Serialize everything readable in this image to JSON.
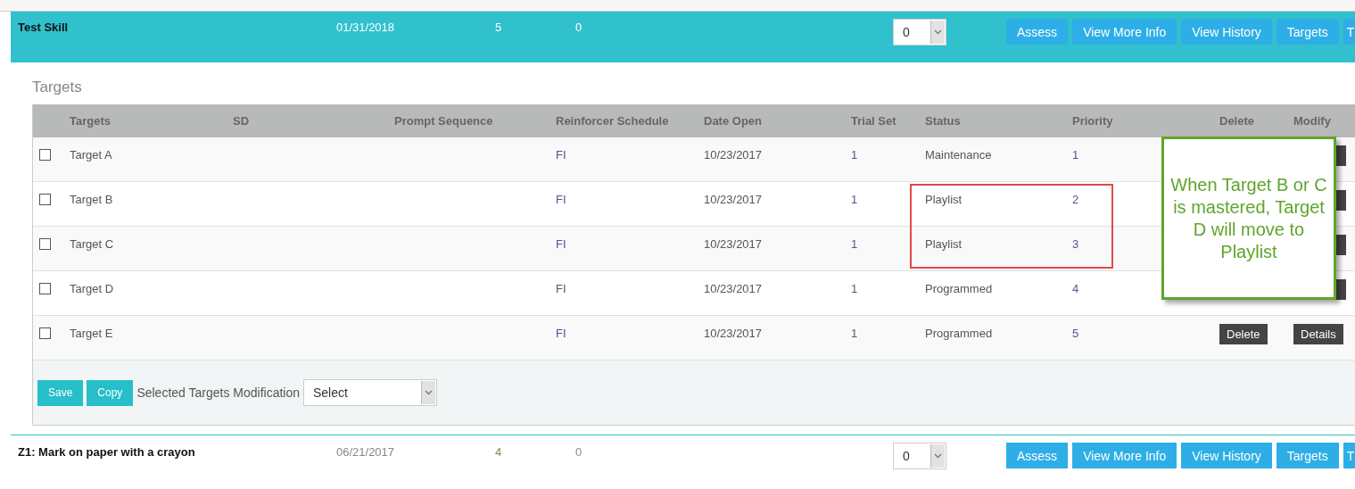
{
  "skills": [
    {
      "name": "Test Skill",
      "date": "01/31/2018",
      "count": "5",
      "value": "0",
      "select_value": "0",
      "expanded": true,
      "buttons": [
        "Assess",
        "View More Info",
        "View History",
        "Targets",
        "T"
      ]
    },
    {
      "name": "Z1: Mark on paper with a crayon",
      "date": "06/21/2017",
      "count": "4",
      "value": "0",
      "select_value": "0",
      "expanded": false,
      "buttons": [
        "Assess",
        "View More Info",
        "View History",
        "Targets",
        "T"
      ]
    }
  ],
  "targets_panel": {
    "title": "Targets",
    "columns": [
      "Targets",
      "SD",
      "Prompt Sequence",
      "Reinforcer Schedule",
      "Date Open",
      "Trial Set",
      "Status",
      "Priority",
      "Delete",
      "Modify"
    ],
    "rows": [
      {
        "checked": false,
        "target": "Target A",
        "schedule": "FI",
        "date": "10/23/2017",
        "trial_set": "1",
        "status": "Maintenance",
        "priority": "1",
        "highlighted": false,
        "covered": true
      },
      {
        "checked": false,
        "target": "Target B",
        "schedule": "FI",
        "date": "10/23/2017",
        "trial_set": "1",
        "status": "Playlist",
        "priority": "2",
        "highlighted": true,
        "covered": true
      },
      {
        "checked": false,
        "target": "Target C",
        "schedule": "FI",
        "date": "10/23/2017",
        "trial_set": "1",
        "status": "Playlist",
        "priority": "3",
        "highlighted": true,
        "covered": true
      },
      {
        "checked": false,
        "target": "Target D",
        "schedule": "FI",
        "date": "10/23/2017",
        "trial_set": "1",
        "status": "Programmed",
        "priority": "4",
        "highlighted": false,
        "covered": true
      },
      {
        "checked": false,
        "target": "Target E",
        "schedule": "FI",
        "date": "10/23/2017",
        "trial_set": "1",
        "status": "Programmed",
        "priority": "5",
        "highlighted": false,
        "covered": false,
        "delete": "Delete",
        "details": "Details"
      }
    ],
    "footer": {
      "save": "Save",
      "copy": "Copy",
      "label": "Selected Targets Modification",
      "select_value": "Select"
    },
    "callout": "When Target B or C is mastered, Target D will move to Playlist"
  }
}
